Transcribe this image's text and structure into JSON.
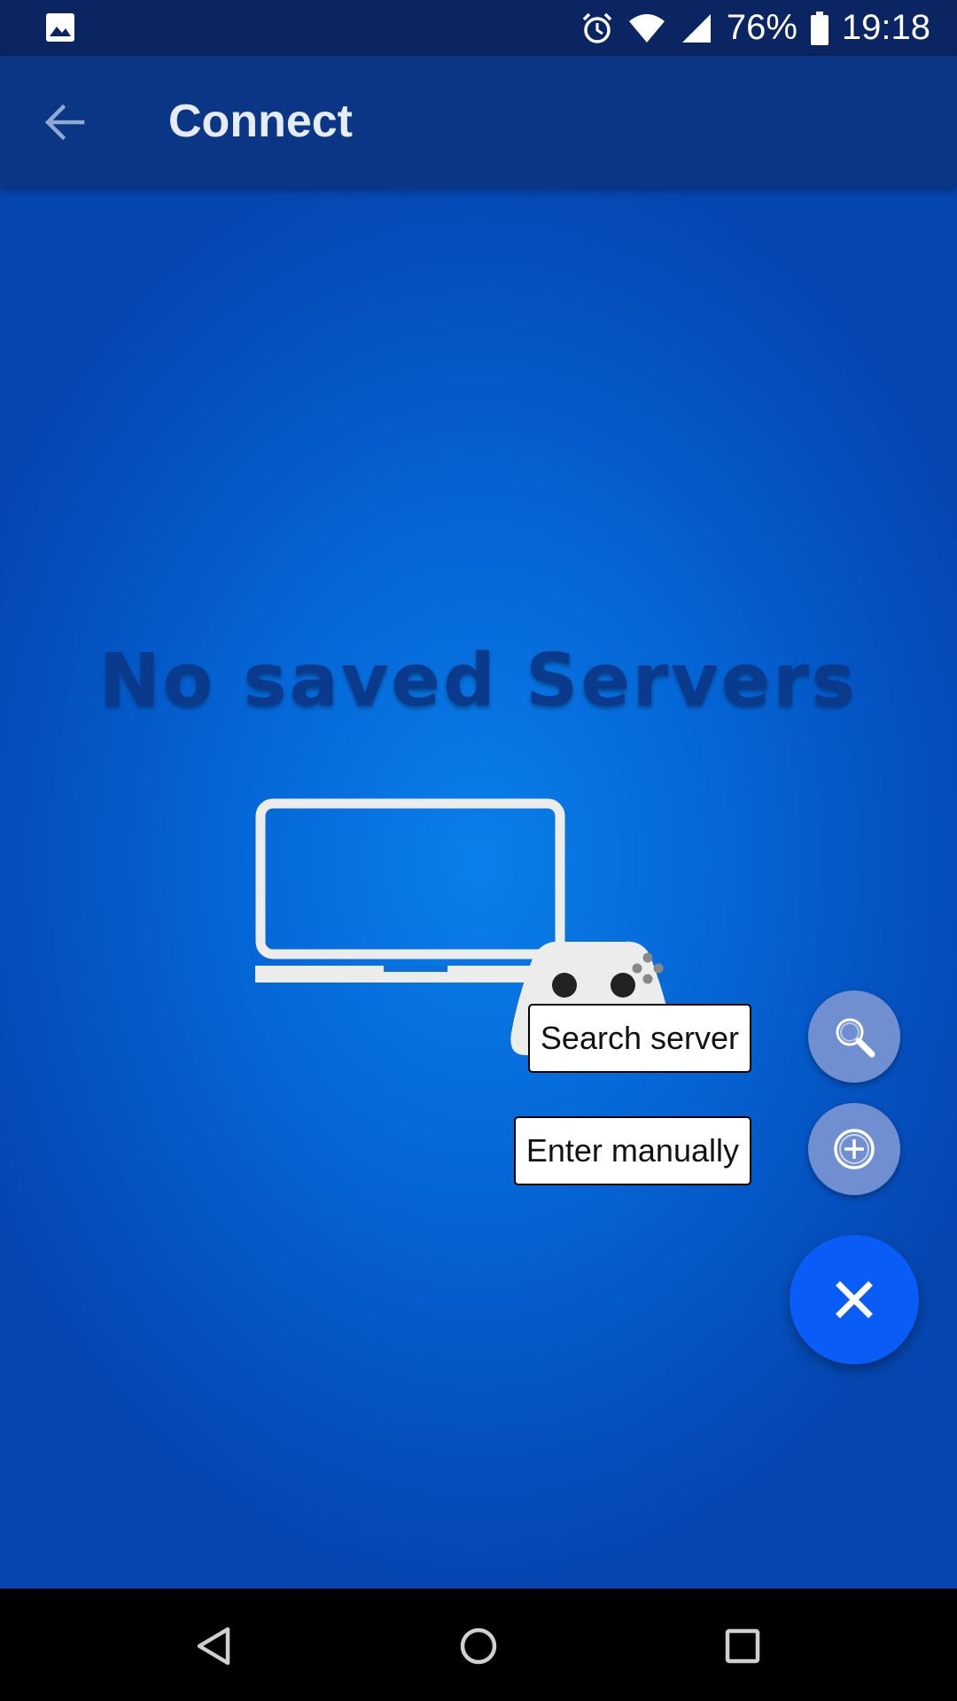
{
  "status_bar": {
    "battery": "76%",
    "time": "19:18",
    "icons": [
      "image-icon",
      "alarm-icon",
      "wifi-icon",
      "signal-icon",
      "battery-icon"
    ]
  },
  "app_bar": {
    "title": "Connect",
    "back_icon": "arrow-left-icon"
  },
  "empty_state": {
    "title": "No saved Servers",
    "illustration": "laptop-with-gamepad"
  },
  "fab_menu": {
    "items": [
      {
        "label": "Search server",
        "icon": "search-icon"
      },
      {
        "label": "Enter manually",
        "icon": "add-circle-icon"
      }
    ],
    "main_icon": "close-icon"
  },
  "nav_bar": {
    "buttons": [
      "back-triangle-icon",
      "home-circle-icon",
      "recents-square-icon"
    ]
  },
  "colors": {
    "status_bar": "#0a2561",
    "app_bar": "#0a3685",
    "content_center": "#0a7fea",
    "content_edge": "#0546b0",
    "empty_title": "#0a3a8c",
    "mini_fab": "#6f8fd0",
    "main_fab": "#0a5cf6"
  }
}
